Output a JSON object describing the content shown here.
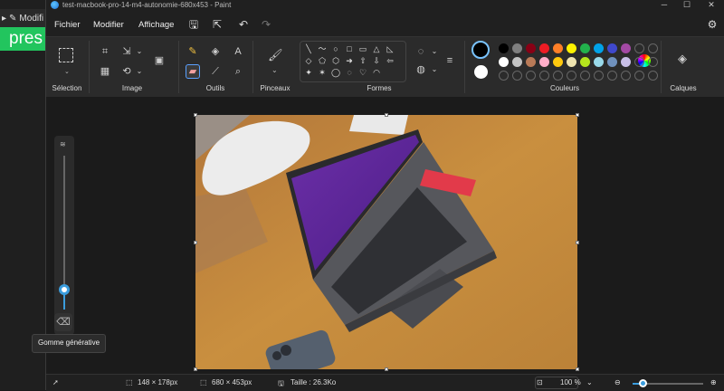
{
  "background_app": {
    "menu_text": "Modifi",
    "banner_text": "pres"
  },
  "window": {
    "title": "test-macbook-pro-14-m4-autonomie-680x453 - Paint",
    "controls": {
      "minimize": "─",
      "maximize": "☐",
      "close": "✕"
    }
  },
  "menu": {
    "file": "Fichier",
    "edit": "Modifier",
    "view": "Affichage"
  },
  "ribbon": {
    "groups": {
      "selection": "Sélection",
      "image": "Image",
      "tools": "Outils",
      "brushes": "Pinceaux",
      "shapes": "Formes",
      "colors": "Couleurs",
      "layers": "Calques"
    },
    "shapes": [
      "╲",
      "〜",
      "○",
      "□",
      "▭",
      "△",
      "◺",
      "◇",
      "⬠",
      "⬡",
      "➜",
      "⇧",
      "⇩",
      "⇦",
      "✦",
      "✶",
      "◯",
      "◌",
      "♡",
      "◠"
    ],
    "palette_row1": [
      "#000000",
      "#7f7f7f",
      "#880015",
      "#ed1c24",
      "#ff7f27",
      "#fff200",
      "#22b14c",
      "#00a2e8",
      "#3f48cc",
      "#a349a4"
    ],
    "palette_row2": [
      "#ffffff",
      "#c3c3c3",
      "#b97a57",
      "#ffaec9",
      "#ffc90e",
      "#efe4b0",
      "#b5e61d",
      "#99d9ea",
      "#7092be",
      "#c8bfe7"
    ],
    "primary_color": "#000000",
    "secondary_color": "#ffffff"
  },
  "eraser": {
    "tooltip": "Gomme générative",
    "size_level": 0.13
  },
  "status": {
    "selection_size": "148 × 178px",
    "image_size": "680 × 453px",
    "file_size": "Taille : 26.3Ko",
    "zoom": "100 %"
  },
  "colors": {
    "accent": "#3b9ddd",
    "window_bg": "#202020",
    "ribbon_bg": "#2b2b2b"
  }
}
